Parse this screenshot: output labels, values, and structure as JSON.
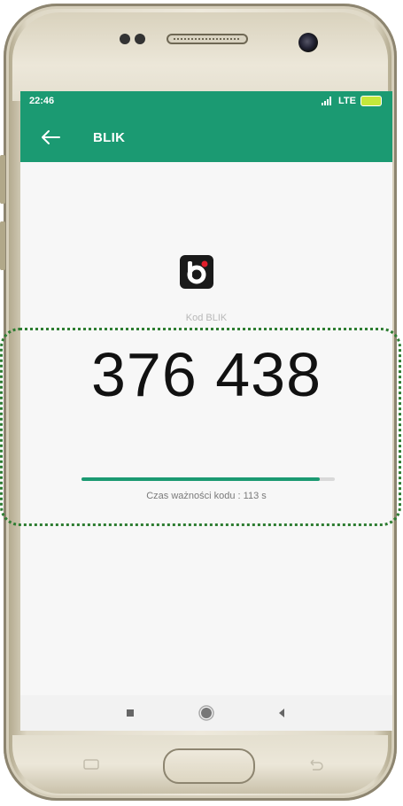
{
  "status_bar": {
    "time": "22:46",
    "network": "LTE"
  },
  "app_bar": {
    "title": "BLIK"
  },
  "blik": {
    "label": "Kod BLIK",
    "code": "376 438",
    "validity_text": "Czas ważności kodu : 113 s",
    "validity_fraction": 0.94
  },
  "colors": {
    "accent": "#1b9a72",
    "blik_red": "#e11d2b"
  },
  "icons": {
    "back": "arrow-left-icon",
    "logo": "blik-logo-icon",
    "recent_apps": "square-icon",
    "home": "circle-icon",
    "back_nav": "triangle-left-icon"
  }
}
